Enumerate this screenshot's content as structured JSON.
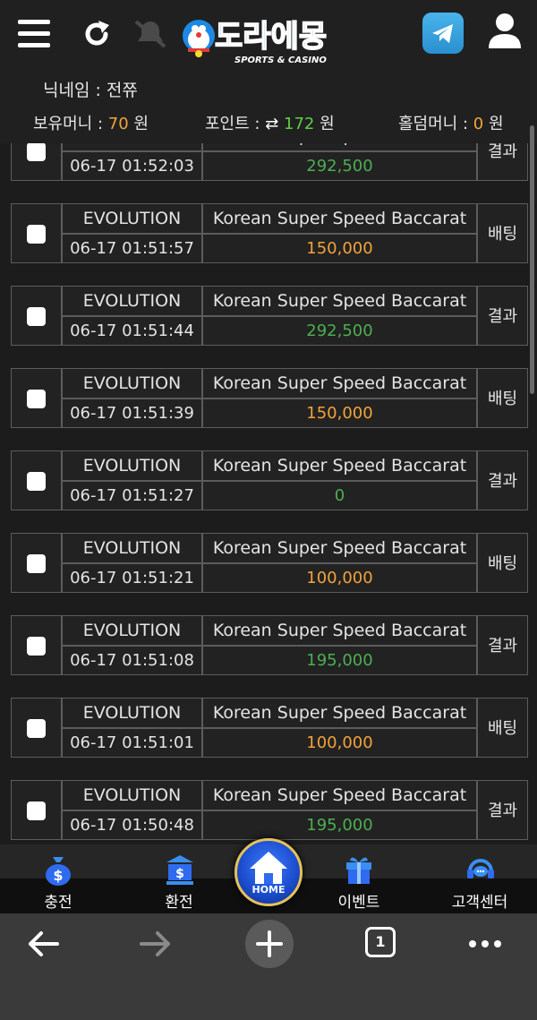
{
  "header": {
    "logo_text": "도라에몽",
    "logo_sub": "SPORTS & CASINO",
    "nickname_label": "닉네임 : 전쮸",
    "balance_label": "보유머니 :",
    "balance_value": "70",
    "point_label": "포인트 :",
    "point_value": "172",
    "holdem_label": "홀덤머니 :",
    "holdem_value": "0",
    "currency": "원"
  },
  "records": [
    {
      "provider": "EVOLUTION",
      "game": "Korean Super Speed Baccarat",
      "time": "06-17 01:52:03",
      "amount": "292,500",
      "type": "결과"
    },
    {
      "provider": "EVOLUTION",
      "game": "Korean Super Speed Baccarat",
      "time": "06-17 01:51:57",
      "amount": "150,000",
      "type": "배팅"
    },
    {
      "provider": "EVOLUTION",
      "game": "Korean Super Speed Baccarat",
      "time": "06-17 01:51:44",
      "amount": "292,500",
      "type": "결과"
    },
    {
      "provider": "EVOLUTION",
      "game": "Korean Super Speed Baccarat",
      "time": "06-17 01:51:39",
      "amount": "150,000",
      "type": "배팅"
    },
    {
      "provider": "EVOLUTION",
      "game": "Korean Super Speed Baccarat",
      "time": "06-17 01:51:27",
      "amount": "0",
      "type": "결과"
    },
    {
      "provider": "EVOLUTION",
      "game": "Korean Super Speed Baccarat",
      "time": "06-17 01:51:21",
      "amount": "100,000",
      "type": "배팅"
    },
    {
      "provider": "EVOLUTION",
      "game": "Korean Super Speed Baccarat",
      "time": "06-17 01:51:08",
      "amount": "195,000",
      "type": "결과"
    },
    {
      "provider": "EVOLUTION",
      "game": "Korean Super Speed Baccarat",
      "time": "06-17 01:51:01",
      "amount": "100,000",
      "type": "배팅"
    },
    {
      "provider": "EVOLUTION",
      "game": "Korean Super Speed Baccarat",
      "time": "06-17 01:50:48",
      "amount": "195,000",
      "type": "결과"
    }
  ],
  "bottom_nav": {
    "deposit": "충전",
    "withdraw": "환전",
    "home": "HOME",
    "event": "이벤트",
    "support": "고객센터"
  },
  "browser": {
    "tab_count": "1"
  },
  "colors": {
    "result": "#4caf50",
    "bet": "#f2a33a",
    "accent_blue": "#2f6bf0"
  },
  "icons": [
    "menu-icon",
    "refresh-icon",
    "mute-icon",
    "telegram-icon",
    "user-icon",
    "money-bag-icon",
    "bank-icon",
    "home-icon",
    "gift-icon",
    "headset-icon",
    "back-arrow-icon",
    "forward-arrow-icon",
    "plus-icon",
    "tabs-icon",
    "more-icon"
  ]
}
